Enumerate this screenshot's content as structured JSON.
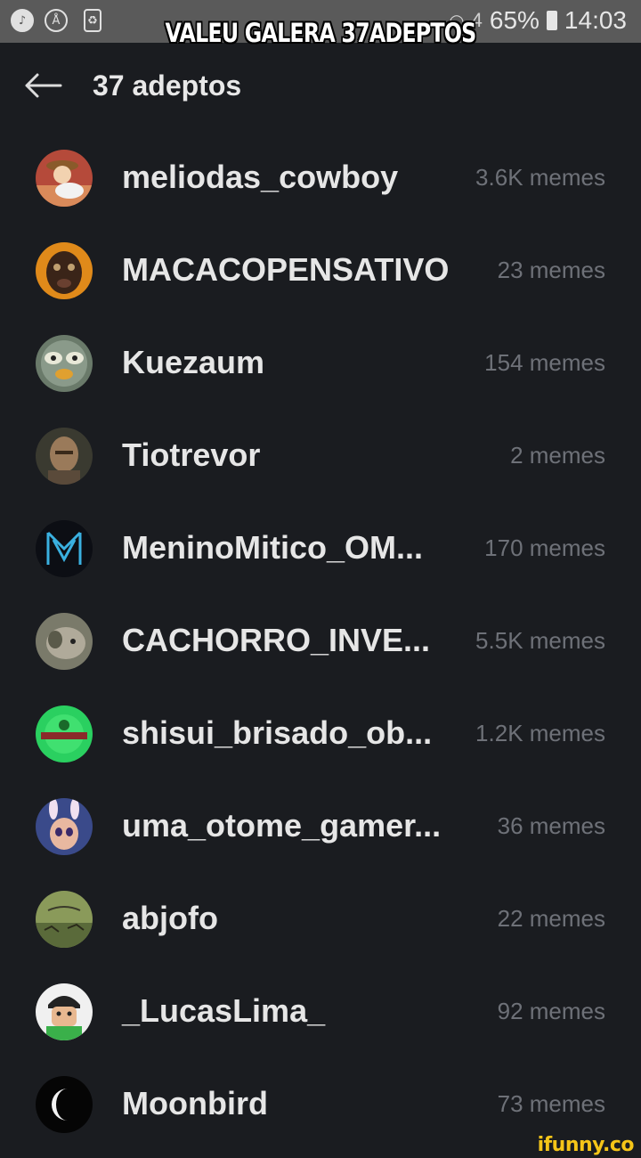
{
  "status_bar": {
    "battery": "65%",
    "time": "14:03",
    "signal": "4",
    "icons": [
      "music-icon",
      "android-icon",
      "recycle-icon"
    ]
  },
  "caption": "VALEU GALERA 37ADEPTOS",
  "header": {
    "title": "37 adeptos",
    "back_icon": "arrow-left-icon"
  },
  "users": [
    {
      "name": "meliodas_cowboy",
      "memes": "3.6K memes"
    },
    {
      "name": "MACACOPENSATIVO",
      "memes": "23 memes"
    },
    {
      "name": "Kuezaum",
      "memes": "154 memes"
    },
    {
      "name": "Tiotrevor",
      "memes": "2 memes"
    },
    {
      "name": "MeninoMitico_OM...",
      "memes": "170 memes"
    },
    {
      "name": "CACHORRO_INVE...",
      "memes": "5.5K memes"
    },
    {
      "name": "shisui_brisado_ob...",
      "memes": "1.2K memes"
    },
    {
      "name": "uma_otome_gamer...",
      "memes": "36 memes"
    },
    {
      "name": "abjofo",
      "memes": "22 memes"
    },
    {
      "name": "_LucasLima_",
      "memes": "92 memes"
    },
    {
      "name": "Moonbird",
      "memes": "73 memes"
    }
  ],
  "watermark": "ifunny.co",
  "colors": {
    "background": "#1a1c20",
    "status_bar": "#5a5a5a",
    "username": "#e6e6e6",
    "meme_count": "#6e7178",
    "watermark": "#f5c518"
  }
}
